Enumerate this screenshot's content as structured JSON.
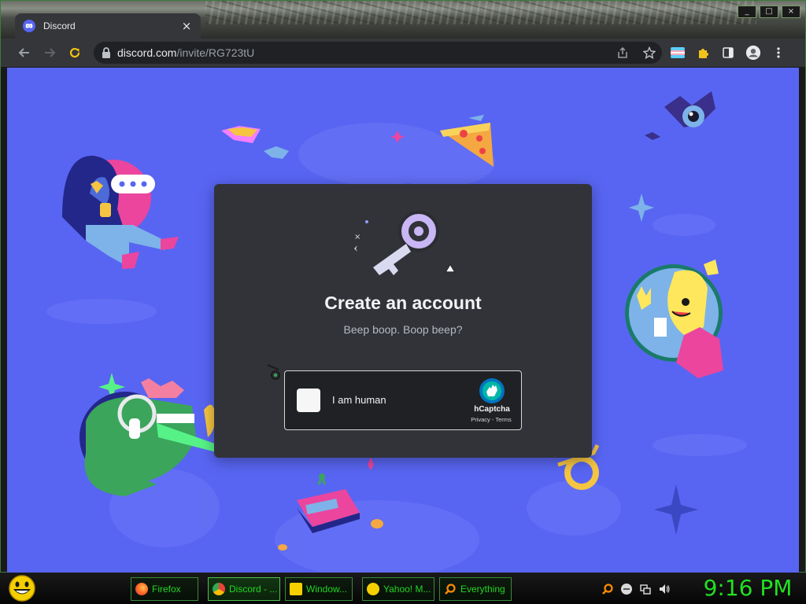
{
  "browser": {
    "tab_title": "Discord",
    "tab_close": "×",
    "url_domain": "discord.com",
    "url_path": "/invite/RG723tU",
    "window_controls": [
      "_",
      "□",
      "×"
    ]
  },
  "page": {
    "background_color": "#5865f2",
    "modal": {
      "title": "Create an account",
      "subtitle": "Beep boop. Boop beep?",
      "captcha": {
        "label": "I am human",
        "brand": "hCaptcha",
        "privacy": "Privacy",
        "separator": " - ",
        "terms": "Terms"
      }
    }
  },
  "taskbar": {
    "buttons": [
      {
        "label": "Firefox",
        "icon": "firefox-icon"
      },
      {
        "label": "Discord - ...",
        "icon": "chrome-icon"
      },
      {
        "label": "Window...",
        "icon": "folder-icon"
      },
      {
        "label": "Yahoo! M...",
        "icon": "yahoo-messenger-icon"
      },
      {
        "label": "Everything",
        "icon": "search-icon"
      }
    ],
    "clock": "9:16 PM"
  },
  "colors": {
    "discord_blurple": "#5865f2",
    "modal_bg": "#313338",
    "taskbar_text": "#22d622"
  }
}
